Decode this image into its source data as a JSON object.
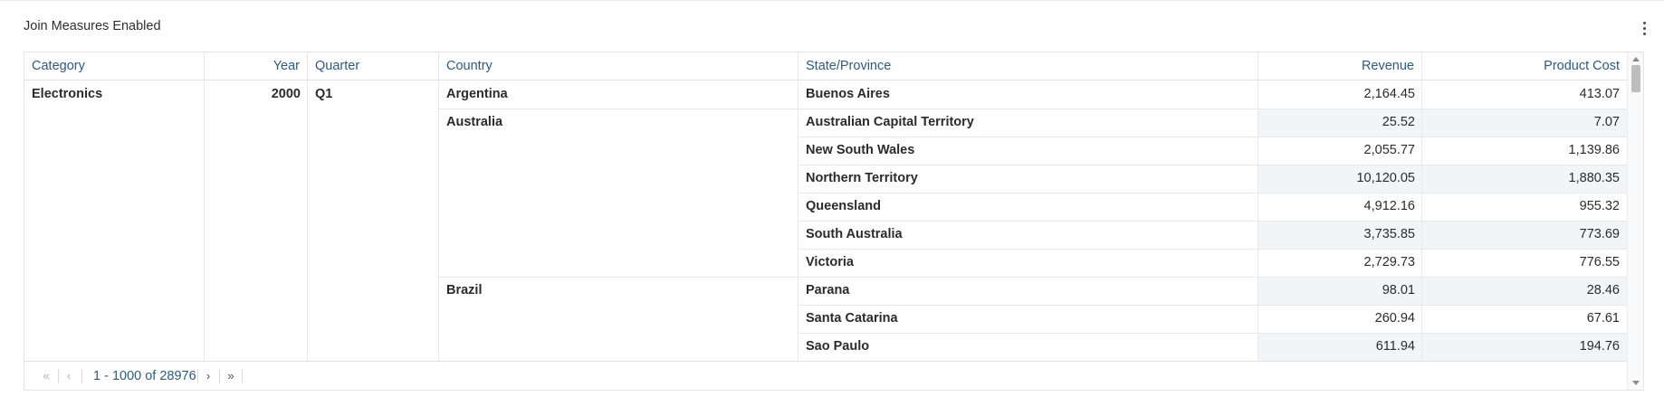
{
  "panel": {
    "title": "Join Measures Enabled",
    "menu_icon": "kebab-menu-icon"
  },
  "table": {
    "columns": [
      "Category",
      "Year",
      "Quarter",
      "Country",
      "State/Province",
      "Revenue",
      "Product Cost"
    ],
    "category": "Electronics",
    "year": "2000",
    "quarter": "Q1",
    "countries": [
      "Argentina",
      "Australia",
      "Brazil"
    ],
    "rows": [
      {
        "state": "Buenos Aires",
        "revenue": "2,164.45",
        "cost": "413.07"
      },
      {
        "state": "Australian Capital Territory",
        "revenue": "25.52",
        "cost": "7.07"
      },
      {
        "state": "New South Wales",
        "revenue": "2,055.77",
        "cost": "1,139.86"
      },
      {
        "state": "Northern Territory",
        "revenue": "10,120.05",
        "cost": "1,880.35"
      },
      {
        "state": "Queensland",
        "revenue": "4,912.16",
        "cost": "955.32"
      },
      {
        "state": "South Australia",
        "revenue": "3,735.85",
        "cost": "773.69"
      },
      {
        "state": "Victoria",
        "revenue": "2,729.73",
        "cost": "776.55"
      },
      {
        "state": "Parana",
        "revenue": "98.01",
        "cost": "28.46"
      },
      {
        "state": "Santa Catarina",
        "revenue": "260.94",
        "cost": "67.61"
      },
      {
        "state": "Sao Paulo",
        "revenue": "611.94",
        "cost": "194.76"
      }
    ]
  },
  "pagination": {
    "first": "«",
    "prev": "‹",
    "range_text": "1 - 1000 of 28976",
    "next": "›",
    "last": "»"
  },
  "colors": {
    "header_text": "#2d5a80",
    "shade": "#f3f4f6"
  }
}
